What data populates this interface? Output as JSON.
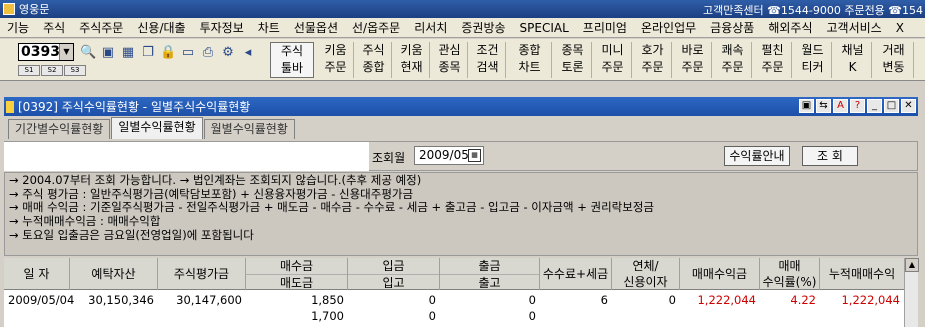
{
  "app": {
    "title": "영웅문",
    "info": "고객만족센터 ☎1544-9000 주문전용 ☎154"
  },
  "menu": [
    "기능",
    "주식",
    "주식주문",
    "신용/대출",
    "투자정보",
    "차트",
    "선물옵션",
    "선/옵주문",
    "리서치",
    "증권방송",
    "SPECIAL",
    "프리미엄",
    "온라인업무",
    "금융상품",
    "해외주식",
    "고객서비스",
    "X"
  ],
  "toolbar": {
    "code": "0393",
    "subtabs": [
      "S1",
      "S2",
      "S3"
    ],
    "stock_toolbar": [
      "주식",
      "툴바"
    ],
    "buttons": [
      [
        "키움",
        "주문"
      ],
      [
        "주식",
        "종합"
      ],
      [
        "키움",
        "현재"
      ],
      [
        "관심",
        "종목"
      ],
      [
        "조건",
        "검색"
      ],
      [
        "종합",
        "차트"
      ],
      [
        "종목",
        "토론"
      ],
      [
        "미니",
        "주문"
      ],
      [
        "호가",
        "주문"
      ],
      [
        "바로",
        "주문"
      ],
      [
        "쾌속",
        "주문"
      ],
      [
        "펼친",
        "주문"
      ],
      [
        "월드",
        "티커"
      ],
      [
        "채널",
        "K"
      ],
      [
        "거래",
        "변동"
      ]
    ]
  },
  "window": {
    "title": "[0392] 주식수익률현황 - 일별주식수익률현황"
  },
  "tabs": [
    "기간별수익률현황",
    "일별수익률현황",
    "월별수익률현황"
  ],
  "active_tab": "일별수익률현황",
  "query": {
    "label": "조회월",
    "value": "2009/05",
    "guide_button": "수익률안내",
    "search_button": "조 회"
  },
  "notes": [
    "→ 2004.07부터 조회 가능합니다. → 법인계좌는 조회되지 않습니다.(추후 제공 예정)",
    "→ 주식  평가금   : 일반주식평가금(예탁담보포함) + 신용융자평가금 - 신용대주평가금",
    "→ 매매  수익금   : 기준일주식평가금 - 전일주식평가금 + 매도금 - 매수금 - 수수료 - 세금 + 출고금 - 입고금 - 이자금액 + 권리락보정금",
    "→ 누적매매수익금 : 매매수익합",
    "→ 토요일 입출금은 금요일(전영업일)에 포함됩니다"
  ],
  "table": {
    "headers": {
      "date": "일 자",
      "deposit": "예탁자산",
      "stock_eval": "주식평가금",
      "buy": "매수금",
      "sell": "매도금",
      "deposit_in": "입금",
      "stock_in": "입고",
      "withdraw": "출금",
      "stock_out": "출고",
      "fee_tax": "수수료+세금",
      "overdue": "연체/",
      "credit_interest": "신용이자",
      "trade_profit": "매매수익금",
      "return_rate_1": "매매",
      "return_rate_2": "수익률(%)",
      "cum_profit": "누적매매수익"
    },
    "rows": [
      {
        "date": "2009/05/04",
        "deposit": "30,150,346",
        "stock_eval": "30,147,600",
        "buy": "1,850",
        "sell": "1,700",
        "deposit_in": "0",
        "stock_in": "0",
        "withdraw": "0",
        "stock_out": "0",
        "fee_tax": "6",
        "interest": "0",
        "trade_profit": "1,222,044",
        "rate": "4.22",
        "cum_profit": "1,222,044"
      }
    ]
  }
}
